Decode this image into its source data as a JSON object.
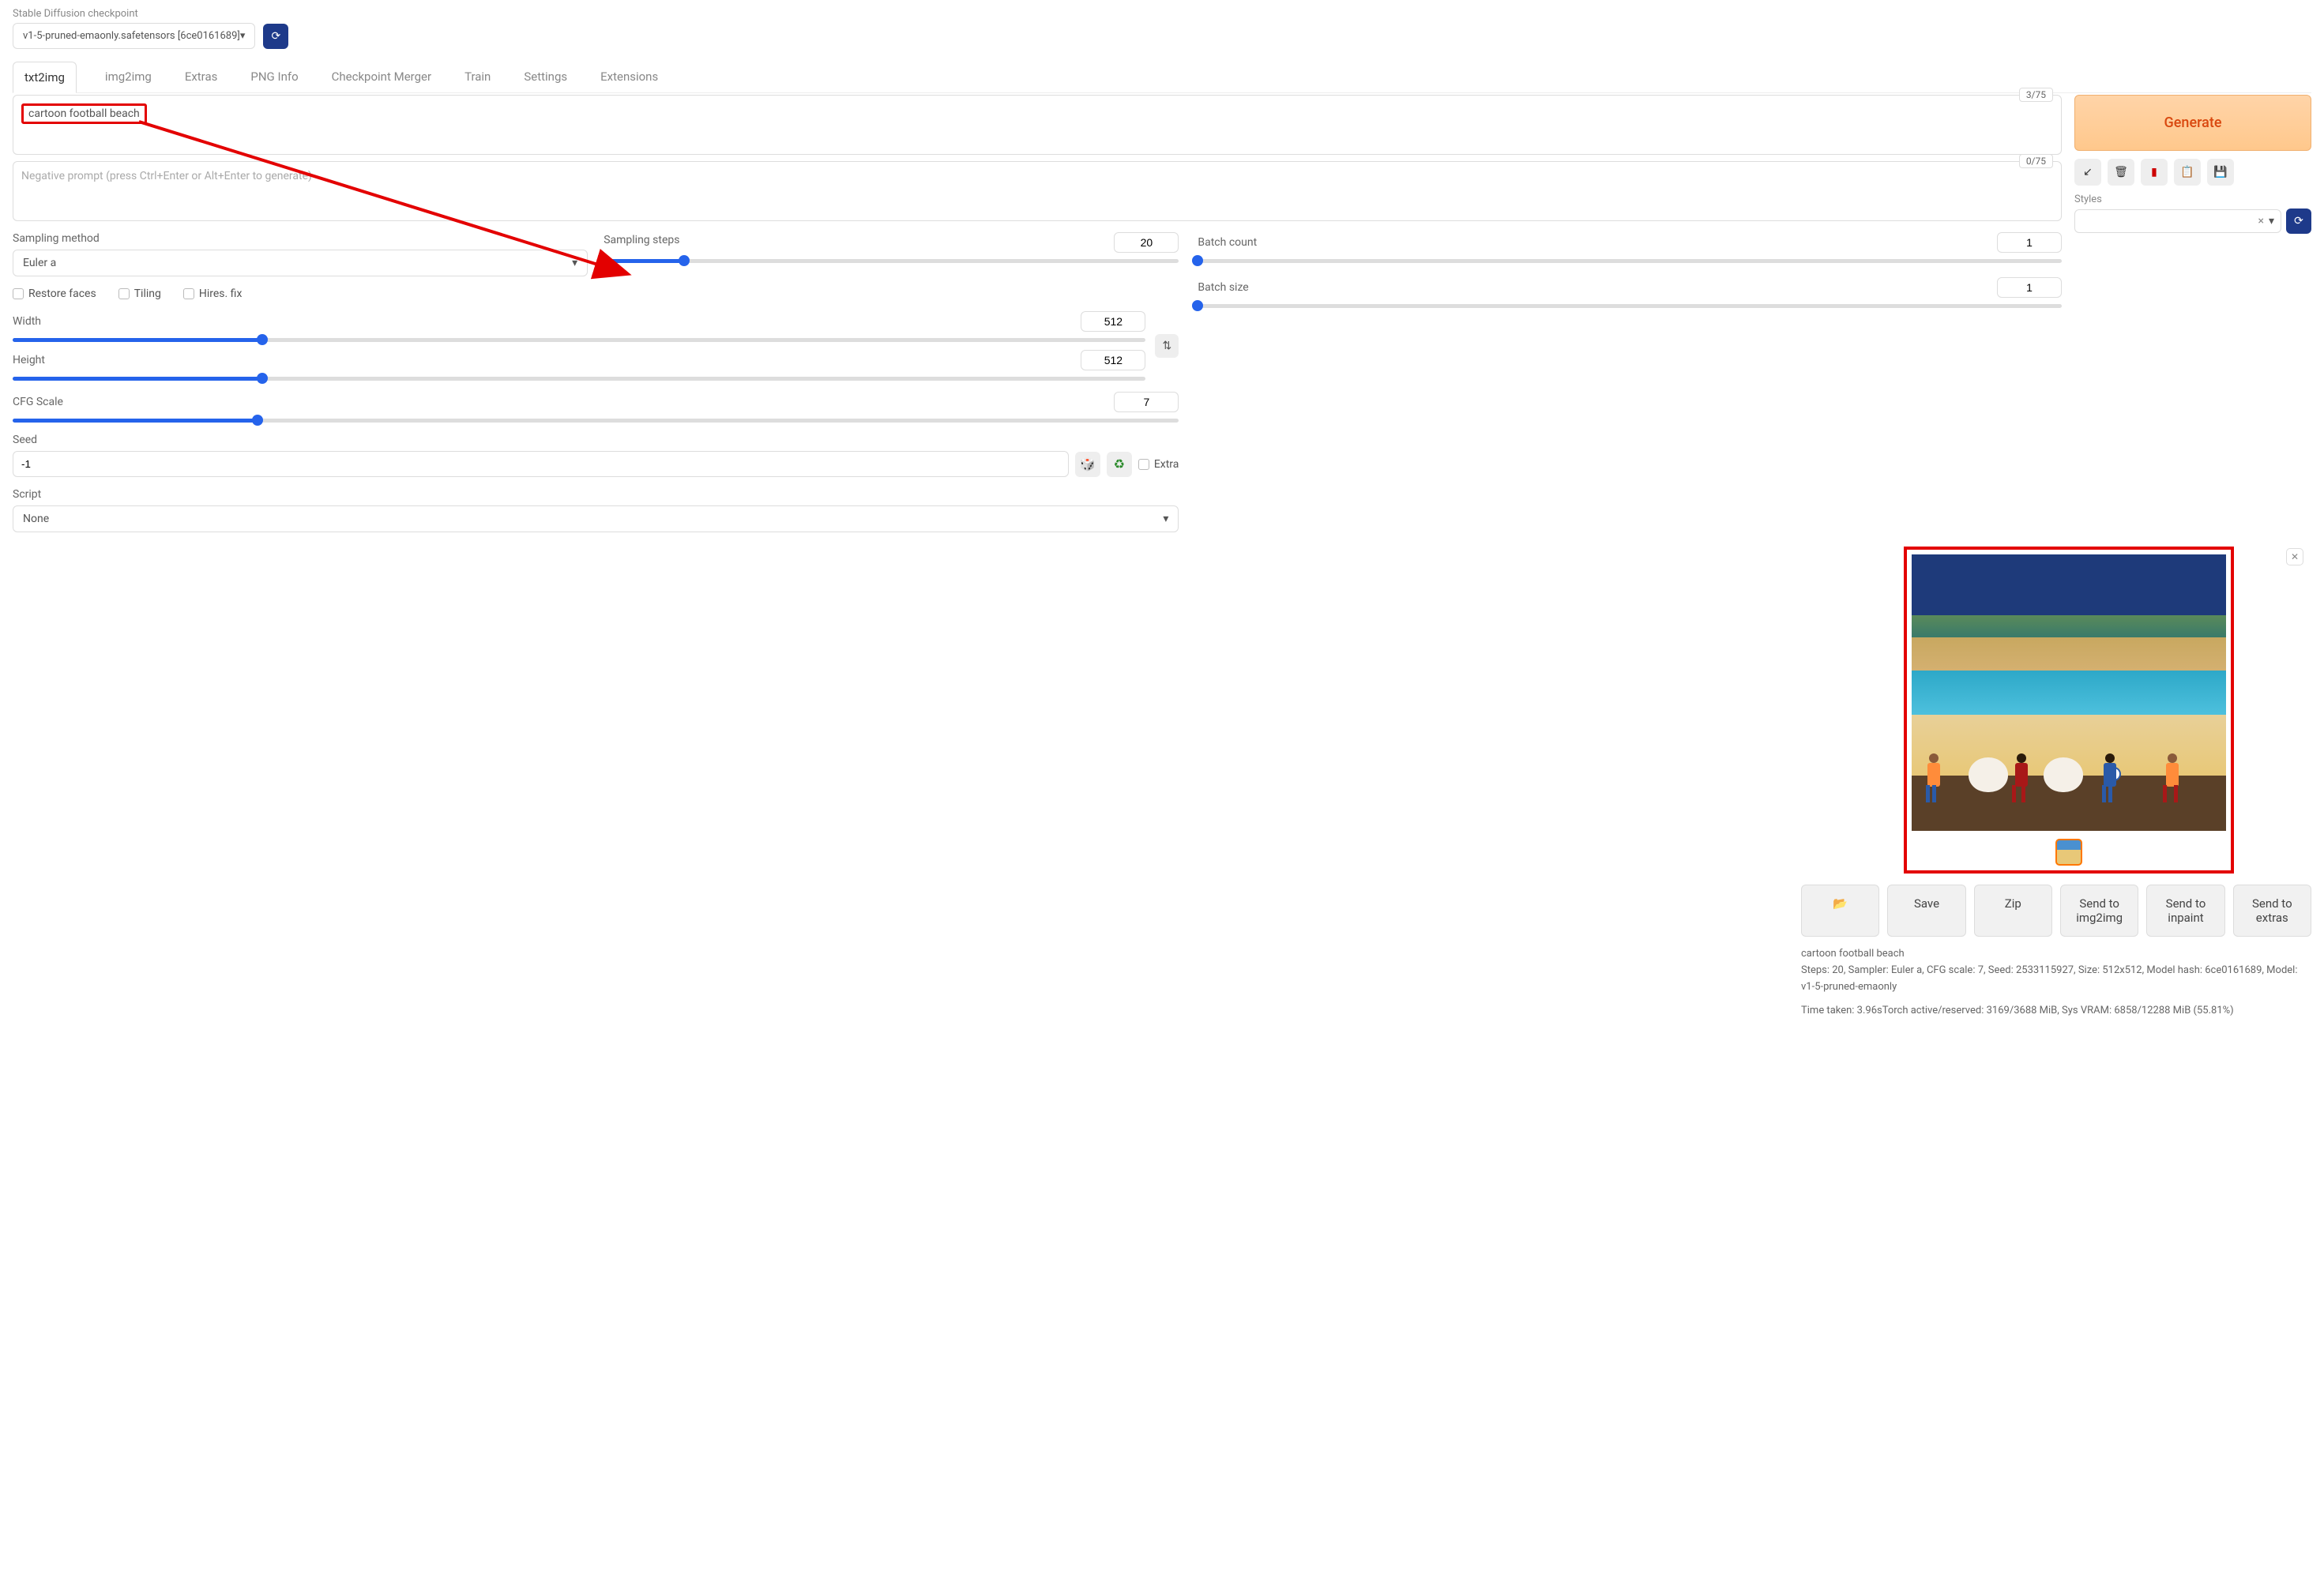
{
  "checkpoint": {
    "label": "Stable Diffusion checkpoint",
    "value": "v1-5-pruned-emaonly.safetensors [6ce0161689]"
  },
  "tabs": [
    "txt2img",
    "img2img",
    "Extras",
    "PNG Info",
    "Checkpoint Merger",
    "Train",
    "Settings",
    "Extensions"
  ],
  "active_tab": "txt2img",
  "prompt": {
    "value": "cartoon football beach",
    "token_count": "3/75"
  },
  "neg_prompt": {
    "placeholder": "Negative prompt (press Ctrl+Enter or Alt+Enter to generate)",
    "token_count": "0/75"
  },
  "sampling": {
    "method_label": "Sampling method",
    "method_value": "Euler a",
    "steps_label": "Sampling steps",
    "steps_value": "20"
  },
  "checks": {
    "restore": "Restore faces",
    "tiling": "Tiling",
    "hires": "Hires. fix"
  },
  "width": {
    "label": "Width",
    "value": "512"
  },
  "height": {
    "label": "Height",
    "value": "512"
  },
  "batch_count": {
    "label": "Batch count",
    "value": "1"
  },
  "batch_size": {
    "label": "Batch size",
    "value": "1"
  },
  "cfg": {
    "label": "CFG Scale",
    "value": "7"
  },
  "seed": {
    "label": "Seed",
    "value": "-1",
    "extra": "Extra"
  },
  "script": {
    "label": "Script",
    "value": "None"
  },
  "generate": {
    "label": "Generate"
  },
  "styles": {
    "label": "Styles"
  },
  "output_buttons": {
    "folder": "📂",
    "save": "Save",
    "zip": "Zip",
    "send_img2img": "Send to img2img",
    "send_inpaint": "Send to inpaint",
    "send_extras": "Send to extras"
  },
  "gen_info": {
    "prompt_line": "cartoon football beach",
    "params_line": "Steps: 20, Sampler: Euler a, CFG scale: 7, Seed: 2533115927, Size: 512x512, Model hash: 6ce0161689, Model: v1-5-pruned-emaonly",
    "time_line": "Time taken: 3.96sTorch active/reserved: 3169/3688 MiB, Sys VRAM: 6858/12288 MiB (55.81%)"
  }
}
